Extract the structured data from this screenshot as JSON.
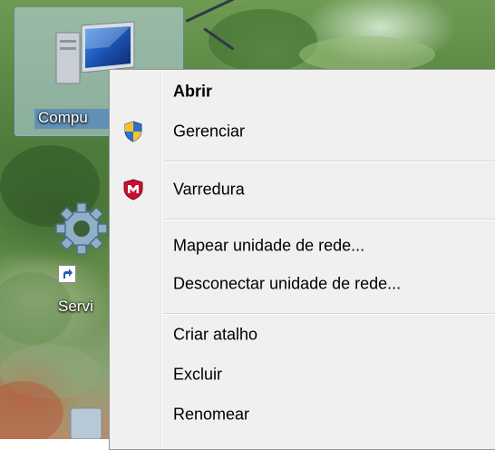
{
  "desktop": {
    "icons": [
      {
        "label": "Compu",
        "icon": "computer-icon"
      },
      {
        "label": "Servi",
        "icon": "gear-icon"
      }
    ]
  },
  "context_menu": {
    "items": [
      {
        "label": "Abrir",
        "bold": true,
        "icon": null
      },
      {
        "label": "Gerenciar",
        "bold": false,
        "icon": "uac-shield-icon"
      },
      {
        "label": "Varredura",
        "bold": false,
        "icon": "mcafee-shield-icon"
      },
      {
        "label": "Mapear unidade de rede...",
        "bold": false,
        "icon": null
      },
      {
        "label": "Desconectar unidade de rede...",
        "bold": false,
        "icon": null
      },
      {
        "label": "Criar atalho",
        "bold": false,
        "icon": null
      },
      {
        "label": "Excluir",
        "bold": false,
        "icon": null
      },
      {
        "label": "Renomear",
        "bold": false,
        "icon": null
      }
    ]
  }
}
